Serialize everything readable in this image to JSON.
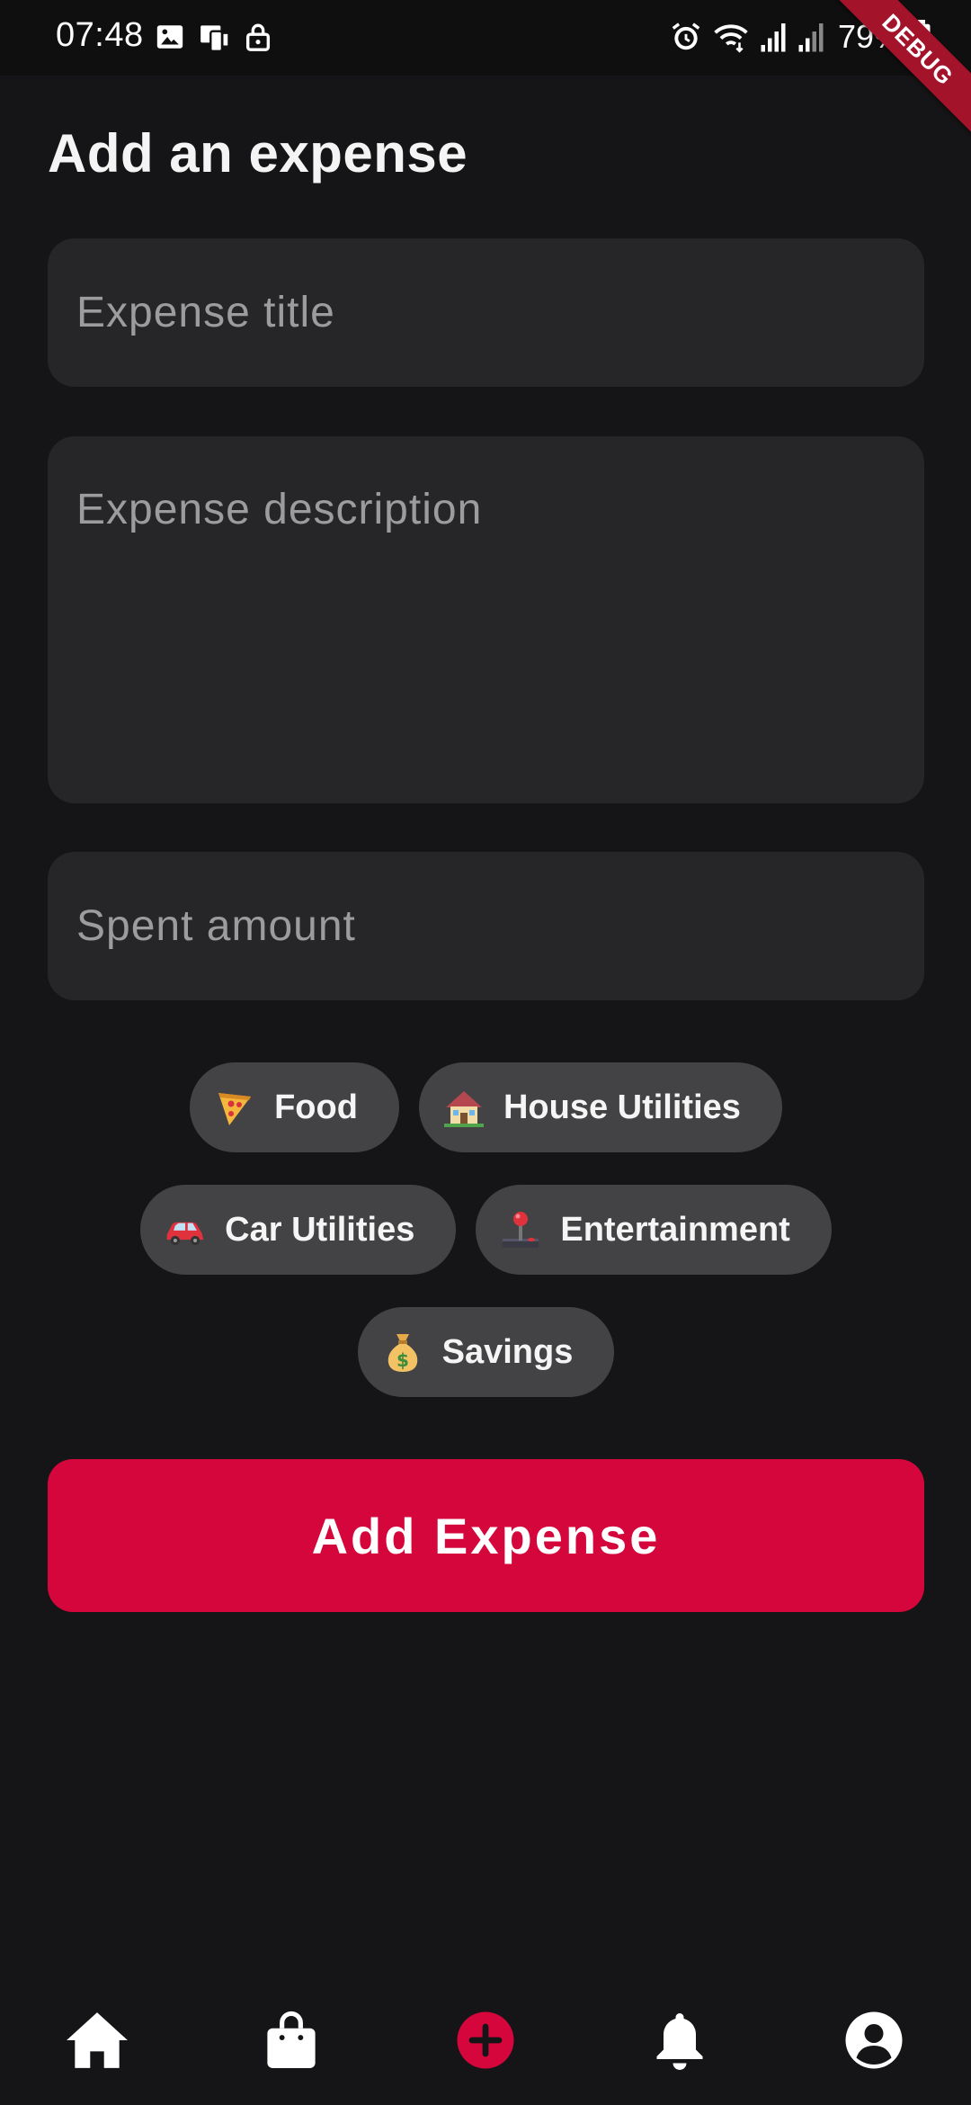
{
  "status_bar": {
    "time": "07:48",
    "battery": "79%",
    "left_icons": [
      "image-icon",
      "phone-cast-icon",
      "lock-icon"
    ],
    "right_icons": [
      "alarm-icon",
      "wifi-icon",
      "signal-icon",
      "signal-icon",
      "battery-icon"
    ]
  },
  "debug_banner": "DEBUG",
  "page": {
    "title": "Add an expense"
  },
  "form": {
    "title_placeholder": "Expense title",
    "title_value": "",
    "description_placeholder": "Expense description",
    "description_value": "",
    "amount_placeholder": "Spent amount",
    "amount_value": ""
  },
  "categories": [
    {
      "label": "Food",
      "icon": "pizza-icon"
    },
    {
      "label": "House Utilities",
      "icon": "house-icon"
    },
    {
      "label": "Car Utilities",
      "icon": "car-icon"
    },
    {
      "label": "Entertainment",
      "icon": "joystick-icon"
    },
    {
      "label": "Savings",
      "icon": "money-bag-icon"
    }
  ],
  "submit_label": "Add Expense",
  "nav": {
    "items": [
      "home-icon",
      "shopping-bag-icon",
      "add-circle-icon",
      "bell-icon",
      "account-icon"
    ],
    "active": "add-circle-icon"
  },
  "colors": {
    "accent": "#d4063c",
    "background": "#151517",
    "field": "#262628",
    "chip": "#434345"
  }
}
